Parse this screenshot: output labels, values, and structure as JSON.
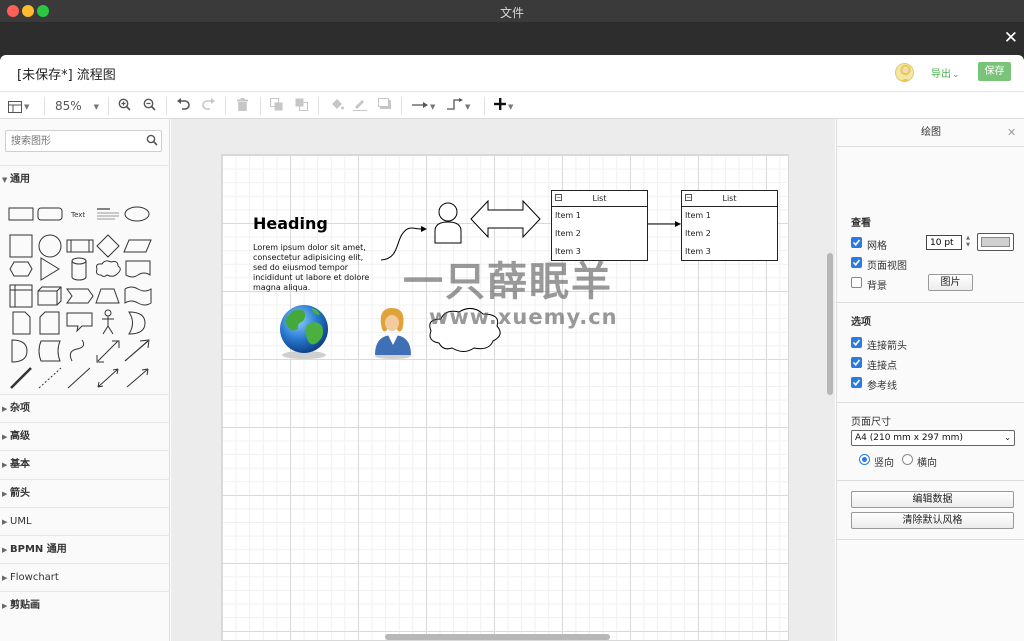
{
  "window": {
    "title": "文件",
    "close_glyph": "✕"
  },
  "header": {
    "doc_title": "[未保存*]  流程图",
    "export_label": "导出",
    "export_caret": "⌄",
    "save_label": "保存"
  },
  "toolbar": {
    "zoom": "85%"
  },
  "sidebar": {
    "search_placeholder": "搜索图形",
    "general_label": "通用",
    "shape_text_label": "Text",
    "sections": [
      "杂项",
      "高级",
      "基本",
      "箭头",
      "UML",
      "BPMN 通用",
      "Flowchart",
      "剪贴画"
    ]
  },
  "canvas": {
    "heading": "Heading",
    "lorem": "Lorem ipsum dolor sit amet, consectetur adipisicing elit, sed do eiusmod tempor incididunt ut labore et dolore magna aliqua.",
    "watermark_cn": "一只薛眠羊",
    "watermark_url": "www.xuemy.cn",
    "list1": {
      "title": "List",
      "items": [
        "Item 1",
        "Item 2",
        "Item 3"
      ]
    },
    "list2": {
      "title": "List",
      "items": [
        "Item 1",
        "Item 2",
        "Item 3"
      ]
    }
  },
  "panel": {
    "title": "绘图",
    "close_glyph": "✕",
    "view_title": "查看",
    "grid_label": "网格",
    "grid_size": "10 pt",
    "page_view_label": "页面视图",
    "background_label": "背景",
    "image_button": "图片",
    "options_title": "选项",
    "connection_arrows_label": "连接箭头",
    "connection_points_label": "连接点",
    "guides_label": "参考线",
    "page_size_title": "页面尺寸",
    "page_size_value": "A4 (210 mm x 297 mm)",
    "portrait_label": "竖向",
    "landscape_label": "横向",
    "edit_data_button": "编辑数据",
    "clear_style_button": "清除默认风格"
  },
  "colors": {
    "accent": "#2b79e3",
    "save_green": "#7ac47a"
  }
}
